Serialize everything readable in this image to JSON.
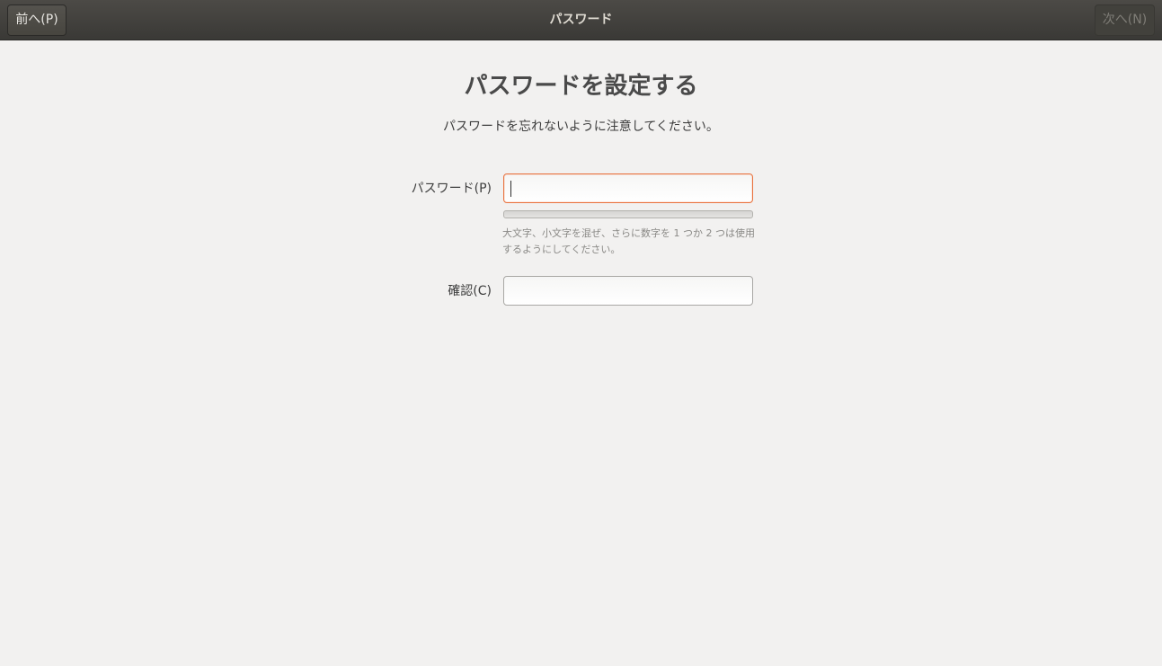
{
  "header": {
    "title": "パスワード",
    "back_label": "前へ(P)",
    "next_label": "次へ(N)",
    "next_enabled": false
  },
  "main": {
    "title": "パスワードを設定する",
    "subtitle": "パスワードを忘れないように注意してください。",
    "password": {
      "label": "パスワード(P)",
      "value": "",
      "focused": true,
      "strength": 0,
      "hint": "大文字、小文字を混ぜ、さらに数字を 1 つか 2 つは使用するようにしてください。"
    },
    "confirm": {
      "label": "確認(C)",
      "value": ""
    }
  },
  "colors": {
    "header_bg": "#3f3e3a",
    "background": "#f2f1f0",
    "focus_accent": "#e9733f"
  }
}
